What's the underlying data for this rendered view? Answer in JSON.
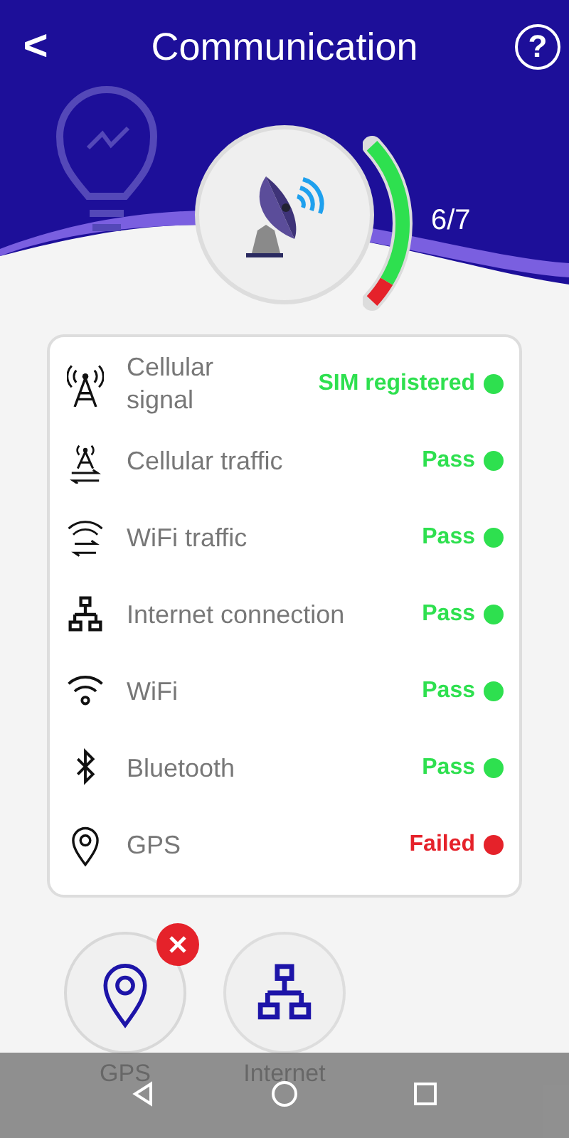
{
  "header": {
    "back": "<",
    "title": "Communication",
    "help": "?"
  },
  "score": {
    "reading": "6/7",
    "level": 0.857
  },
  "checks": [
    {
      "kind": "cell-tower",
      "label": "Cellular signal",
      "status": "SIM registered",
      "passed": true
    },
    {
      "kind": "cell-traffic",
      "label": "Cellular traffic",
      "status": "Pass",
      "passed": true
    },
    {
      "kind": "wifi-traffic",
      "label": "WiFi traffic",
      "status": "Pass",
      "passed": true
    },
    {
      "kind": "network",
      "label": "Internet connection",
      "status": "Pass",
      "passed": true
    },
    {
      "kind": "wifi",
      "label": "WiFi",
      "status": "Pass",
      "passed": true
    },
    {
      "kind": "bluetooth",
      "label": "Bluetooth",
      "status": "Pass",
      "passed": true
    },
    {
      "kind": "location",
      "label": "GPS",
      "status": "Failed",
      "passed": false
    }
  ],
  "shortcuts": [
    {
      "kind": "location",
      "label": "GPS",
      "failed": true
    },
    {
      "kind": "network",
      "label": "Internet",
      "failed": false
    }
  ]
}
